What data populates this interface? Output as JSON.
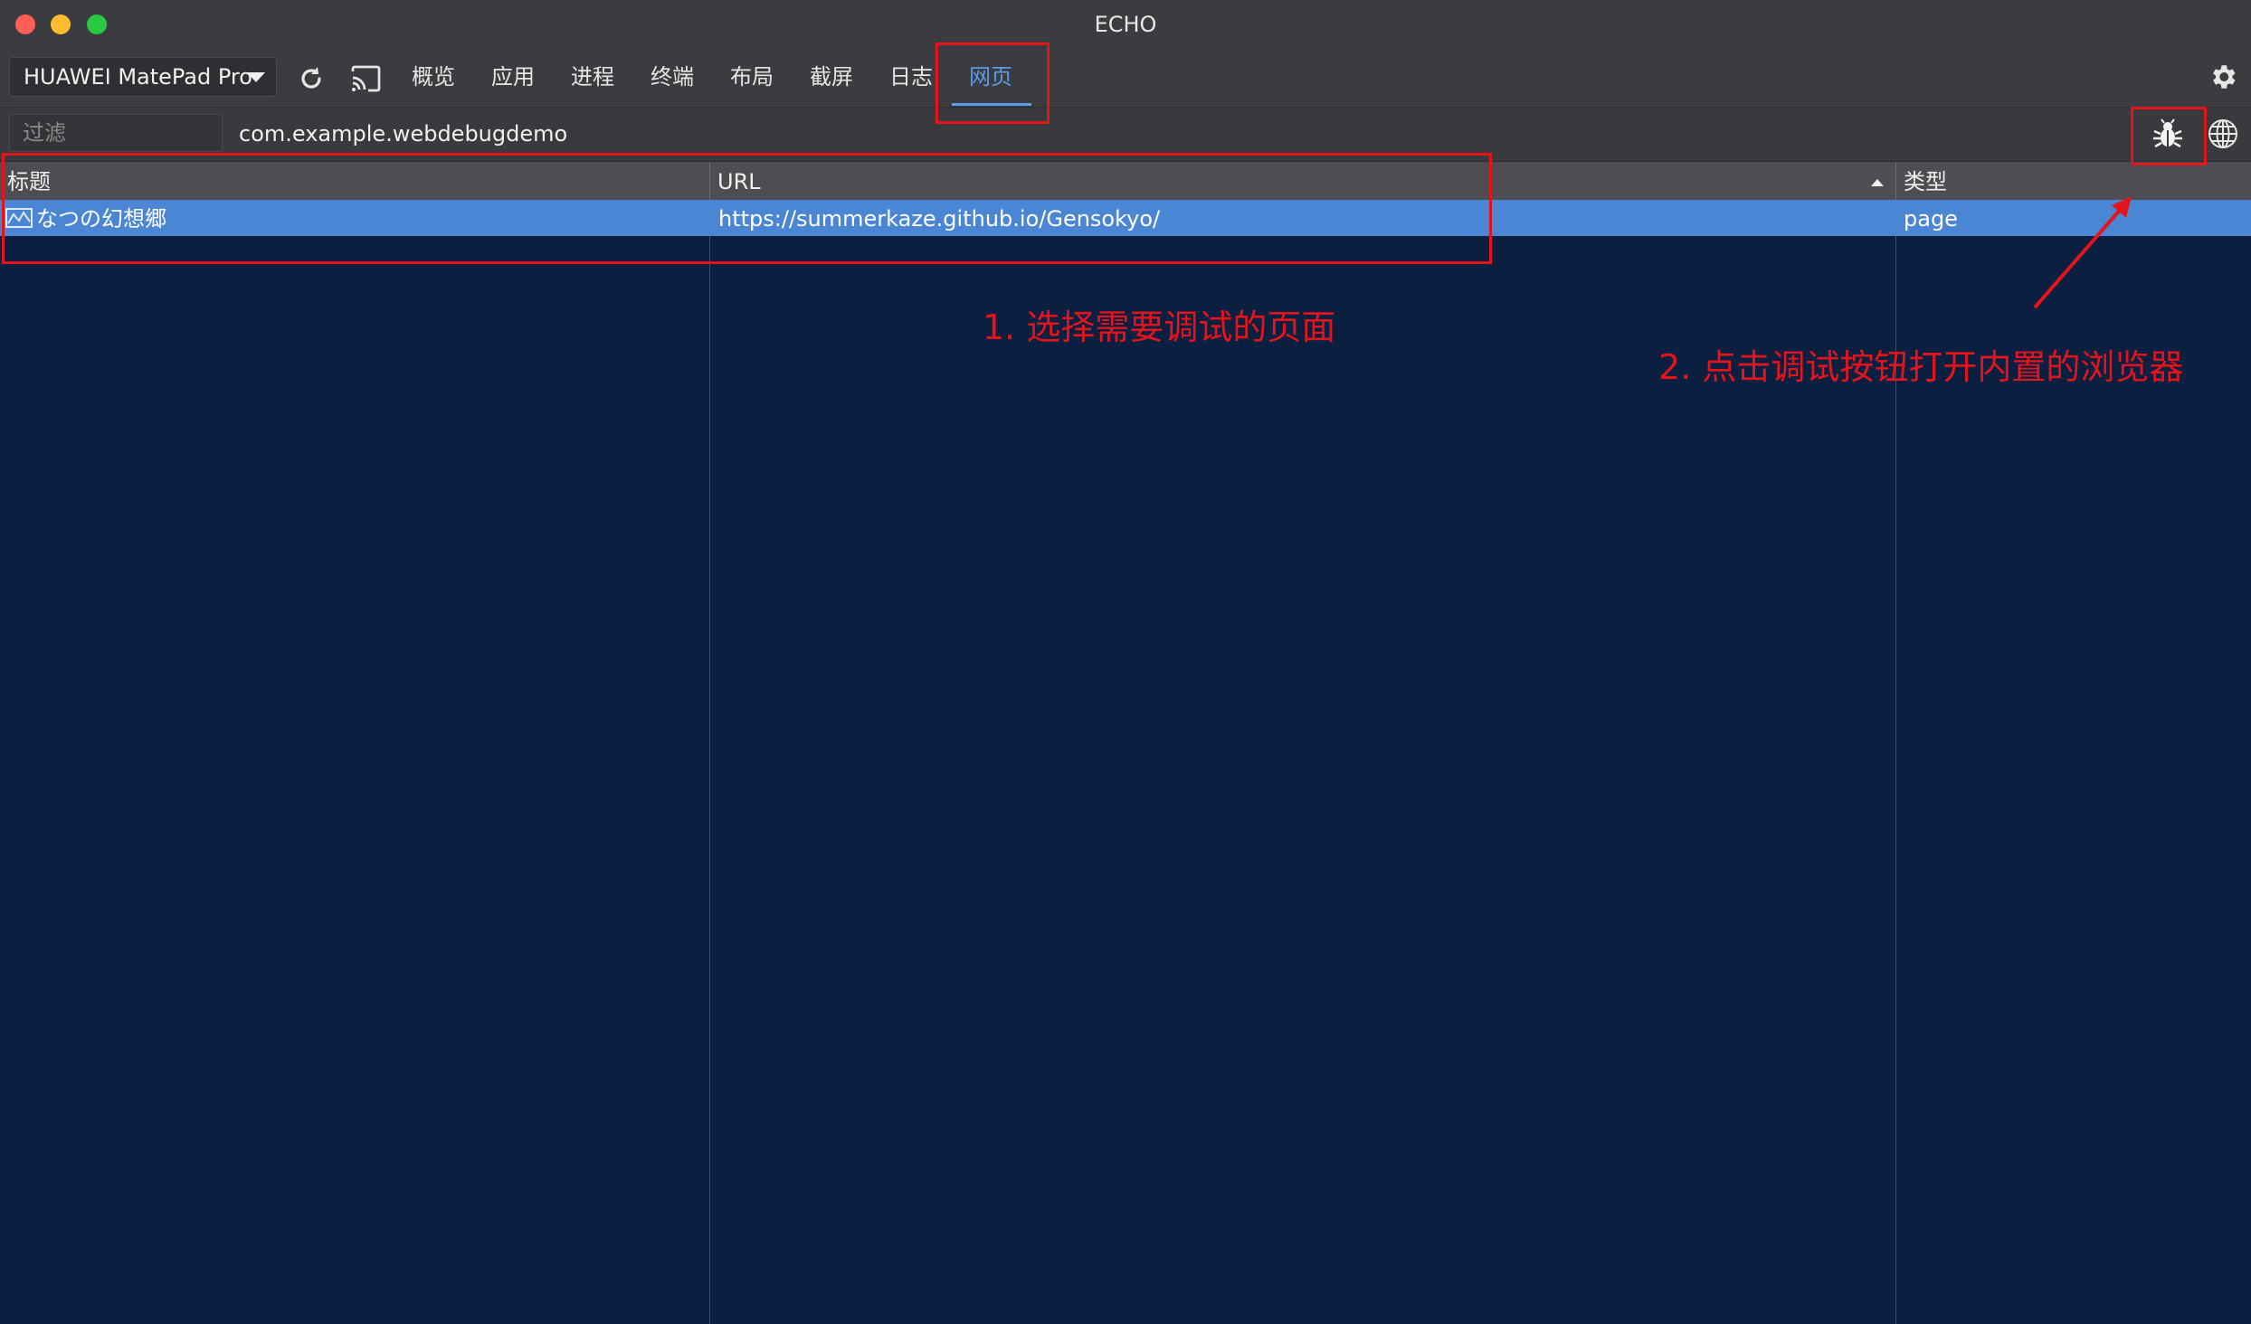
{
  "window": {
    "title": "ECHO"
  },
  "toolbar": {
    "device": "HUAWEI MatePad Pro",
    "refresh_icon": "refresh-icon",
    "cast_icon": "cast-icon",
    "settings_icon": "gear-icon",
    "tabs": [
      {
        "label": "概览",
        "active": false
      },
      {
        "label": "应用",
        "active": false
      },
      {
        "label": "进程",
        "active": false
      },
      {
        "label": "终端",
        "active": false
      },
      {
        "label": "布局",
        "active": false
      },
      {
        "label": "截屏",
        "active": false
      },
      {
        "label": "日志",
        "active": false
      },
      {
        "label": "网页",
        "active": true
      }
    ]
  },
  "filterbar": {
    "placeholder": "过滤",
    "package": "com.example.webdebugdemo",
    "debug_icon": "bug-icon",
    "browser_icon": "globe-icon"
  },
  "table": {
    "columns": [
      "标题",
      "URL",
      "类型"
    ],
    "sort_column": "URL",
    "sort_direction": "ascending",
    "rows": [
      {
        "title": "なつの幻想郷",
        "url": "https://summerkaze.github.io/Gensokyo/",
        "type": "page",
        "selected": true
      }
    ]
  },
  "annotations": {
    "step1": "1. 选择需要调试的页面",
    "step2": "2. 点击调试按钮打开内置的浏览器",
    "color": "#e3141c"
  },
  "colors": {
    "accent": "#5b9be8",
    "selection": "#4a86d4",
    "table_background": "#0b1f40"
  }
}
